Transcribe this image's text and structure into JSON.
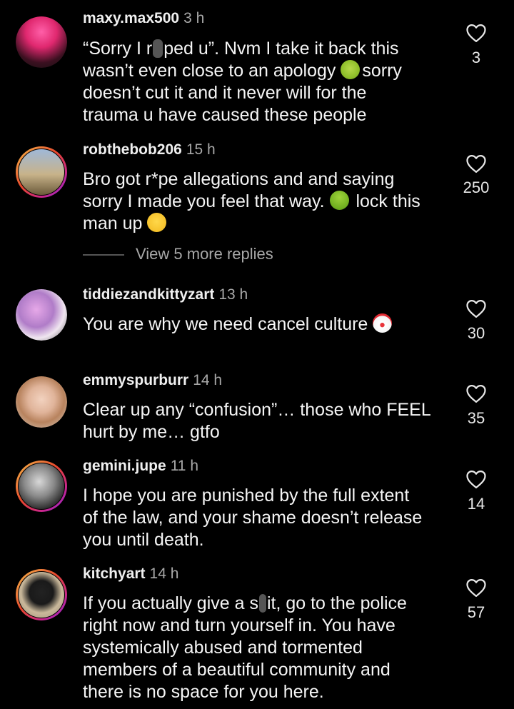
{
  "comments": [
    {
      "username": "maxy.max500",
      "time": "3 h",
      "lines": [
        "“Sorry I r",
        "ped u”. Nvm I take it back this",
        "wasn’t even close to an apology ",
        "sorry",
        "doesn’t cut it and it never will for the",
        "trauma u have caused these people"
      ],
      "likes": "3"
    },
    {
      "username": "robthebob206",
      "time": "15 h",
      "lines": [
        "Bro got r*pe allegations and and saying",
        "sorry I made you feel that way. ",
        " lock this",
        "man up "
      ],
      "likes": "250"
    },
    {
      "username": "tiddiezandkittyzart",
      "time": "13 h",
      "lines": [
        "You are why we need cancel culture "
      ],
      "likes": "30"
    },
    {
      "username": "emmyspurburr",
      "time": "14 h",
      "lines": [
        "Clear up any “confusion”… those who FEEL",
        "hurt by me… gtfo"
      ],
      "likes": "35"
    },
    {
      "username": "gemini.jupe",
      "time": "11 h",
      "lines": [
        "I hope you are punished by the full extent",
        "of the law, and your shame doesn’t release",
        "you until death."
      ],
      "likes": "14"
    },
    {
      "username": "kitchyart",
      "time": "14 h",
      "lines": [
        "If you actually give a s",
        "it, go to the police",
        "right now and turn yourself in. You have",
        "systemically abused and tormented",
        "members of a beautiful community and",
        "there is no space for you here."
      ],
      "likes": "57"
    }
  ],
  "view_replies": "View 5 more replies",
  "icons": {
    "like": "heart-outline-icon",
    "emoji_nauseated": "nauseated-face-emoji",
    "emoji_vomit": "vomiting-face-emoji",
    "emoji_salute": "saluting-face-emoji",
    "emoji_clown": "clown-face-emoji"
  },
  "colors": {
    "background": "#000000",
    "text": "#f5f5f5",
    "muted": "#a8a8a8"
  }
}
